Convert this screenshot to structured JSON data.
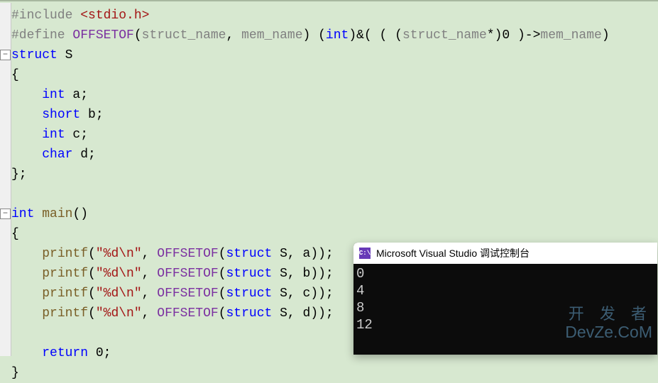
{
  "code_lines": [
    {
      "fold": false,
      "segments": [
        {
          "cls": "c-directive",
          "t": "#include "
        },
        {
          "cls": "c-string",
          "t": "<stdio.h>"
        }
      ]
    },
    {
      "fold": false,
      "segments": [
        {
          "cls": "c-directive",
          "t": "#define "
        },
        {
          "cls": "c-macro",
          "t": "OFFSETOF"
        },
        {
          "cls": "c-text",
          "t": "("
        },
        {
          "cls": "c-param",
          "t": "struct_name"
        },
        {
          "cls": "c-text",
          "t": ", "
        },
        {
          "cls": "c-param",
          "t": "mem_name"
        },
        {
          "cls": "c-text",
          "t": ") ("
        },
        {
          "cls": "c-keyword",
          "t": "int"
        },
        {
          "cls": "c-text",
          "t": ")&( ( ("
        },
        {
          "cls": "c-param",
          "t": "struct_name"
        },
        {
          "cls": "c-text",
          "t": "*)0 )->"
        },
        {
          "cls": "c-param",
          "t": "mem_name"
        },
        {
          "cls": "c-text",
          "t": ")"
        }
      ]
    },
    {
      "fold": true,
      "segments": [
        {
          "cls": "c-keyword",
          "t": "struct"
        },
        {
          "cls": "c-text",
          "t": " S"
        }
      ]
    },
    {
      "fold": false,
      "segments": [
        {
          "cls": "c-text",
          "t": "{"
        }
      ]
    },
    {
      "fold": false,
      "segments": [
        {
          "cls": "c-text",
          "t": "    "
        },
        {
          "cls": "c-keyword",
          "t": "int"
        },
        {
          "cls": "c-text",
          "t": " a;"
        }
      ]
    },
    {
      "fold": false,
      "segments": [
        {
          "cls": "c-text",
          "t": "    "
        },
        {
          "cls": "c-keyword",
          "t": "short"
        },
        {
          "cls": "c-text",
          "t": " b;"
        }
      ]
    },
    {
      "fold": false,
      "segments": [
        {
          "cls": "c-text",
          "t": "    "
        },
        {
          "cls": "c-keyword",
          "t": "int"
        },
        {
          "cls": "c-text",
          "t": " c;"
        }
      ]
    },
    {
      "fold": false,
      "segments": [
        {
          "cls": "c-text",
          "t": "    "
        },
        {
          "cls": "c-keyword",
          "t": "char"
        },
        {
          "cls": "c-text",
          "t": " d;"
        }
      ]
    },
    {
      "fold": false,
      "segments": [
        {
          "cls": "c-text",
          "t": "};"
        }
      ]
    },
    {
      "fold": false,
      "segments": [
        {
          "cls": "c-text",
          "t": ""
        }
      ]
    },
    {
      "fold": true,
      "segments": [
        {
          "cls": "c-keyword",
          "t": "int"
        },
        {
          "cls": "c-text",
          "t": " "
        },
        {
          "cls": "c-func",
          "t": "main"
        },
        {
          "cls": "c-text",
          "t": "()"
        }
      ]
    },
    {
      "fold": false,
      "segments": [
        {
          "cls": "c-text",
          "t": "{"
        }
      ]
    },
    {
      "fold": false,
      "segments": [
        {
          "cls": "c-text",
          "t": "    "
        },
        {
          "cls": "c-func",
          "t": "printf"
        },
        {
          "cls": "c-text",
          "t": "("
        },
        {
          "cls": "c-string",
          "t": "\"%d\\n\""
        },
        {
          "cls": "c-text",
          "t": ", "
        },
        {
          "cls": "c-macro",
          "t": "OFFSETOF"
        },
        {
          "cls": "c-text",
          "t": "("
        },
        {
          "cls": "c-keyword",
          "t": "struct"
        },
        {
          "cls": "c-text",
          "t": " S, a));"
        }
      ]
    },
    {
      "fold": false,
      "segments": [
        {
          "cls": "c-text",
          "t": "    "
        },
        {
          "cls": "c-func",
          "t": "printf"
        },
        {
          "cls": "c-text",
          "t": "("
        },
        {
          "cls": "c-string",
          "t": "\"%d\\n\""
        },
        {
          "cls": "c-text",
          "t": ", "
        },
        {
          "cls": "c-macro",
          "t": "OFFSETOF"
        },
        {
          "cls": "c-text",
          "t": "("
        },
        {
          "cls": "c-keyword",
          "t": "struct"
        },
        {
          "cls": "c-text",
          "t": " S, b));"
        }
      ]
    },
    {
      "fold": false,
      "segments": [
        {
          "cls": "c-text",
          "t": "    "
        },
        {
          "cls": "c-func",
          "t": "printf"
        },
        {
          "cls": "c-text",
          "t": "("
        },
        {
          "cls": "c-string",
          "t": "\"%d\\n\""
        },
        {
          "cls": "c-text",
          "t": ", "
        },
        {
          "cls": "c-macro",
          "t": "OFFSETOF"
        },
        {
          "cls": "c-text",
          "t": "("
        },
        {
          "cls": "c-keyword",
          "t": "struct"
        },
        {
          "cls": "c-text",
          "t": " S, c));"
        }
      ]
    },
    {
      "fold": false,
      "segments": [
        {
          "cls": "c-text",
          "t": "    "
        },
        {
          "cls": "c-func",
          "t": "printf"
        },
        {
          "cls": "c-text",
          "t": "("
        },
        {
          "cls": "c-string",
          "t": "\"%d\\n\""
        },
        {
          "cls": "c-text",
          "t": ", "
        },
        {
          "cls": "c-macro",
          "t": "OFFSETOF"
        },
        {
          "cls": "c-text",
          "t": "("
        },
        {
          "cls": "c-keyword",
          "t": "struct"
        },
        {
          "cls": "c-text",
          "t": " S, d));"
        }
      ]
    },
    {
      "fold": false,
      "segments": [
        {
          "cls": "c-text",
          "t": ""
        }
      ]
    },
    {
      "fold": false,
      "segments": [
        {
          "cls": "c-text",
          "t": "    "
        },
        {
          "cls": "c-keyword",
          "t": "return"
        },
        {
          "cls": "c-text",
          "t": " 0;"
        }
      ]
    },
    {
      "fold": false,
      "segments": [
        {
          "cls": "c-text",
          "t": "}"
        }
      ]
    }
  ],
  "console": {
    "icon_text": "C:\\",
    "title": "Microsoft Visual Studio 调试控制台",
    "output_lines": [
      "0",
      "4",
      "8",
      "12"
    ]
  },
  "watermark": {
    "line1": "开 发 者",
    "line2": "DevZe.CoM"
  }
}
